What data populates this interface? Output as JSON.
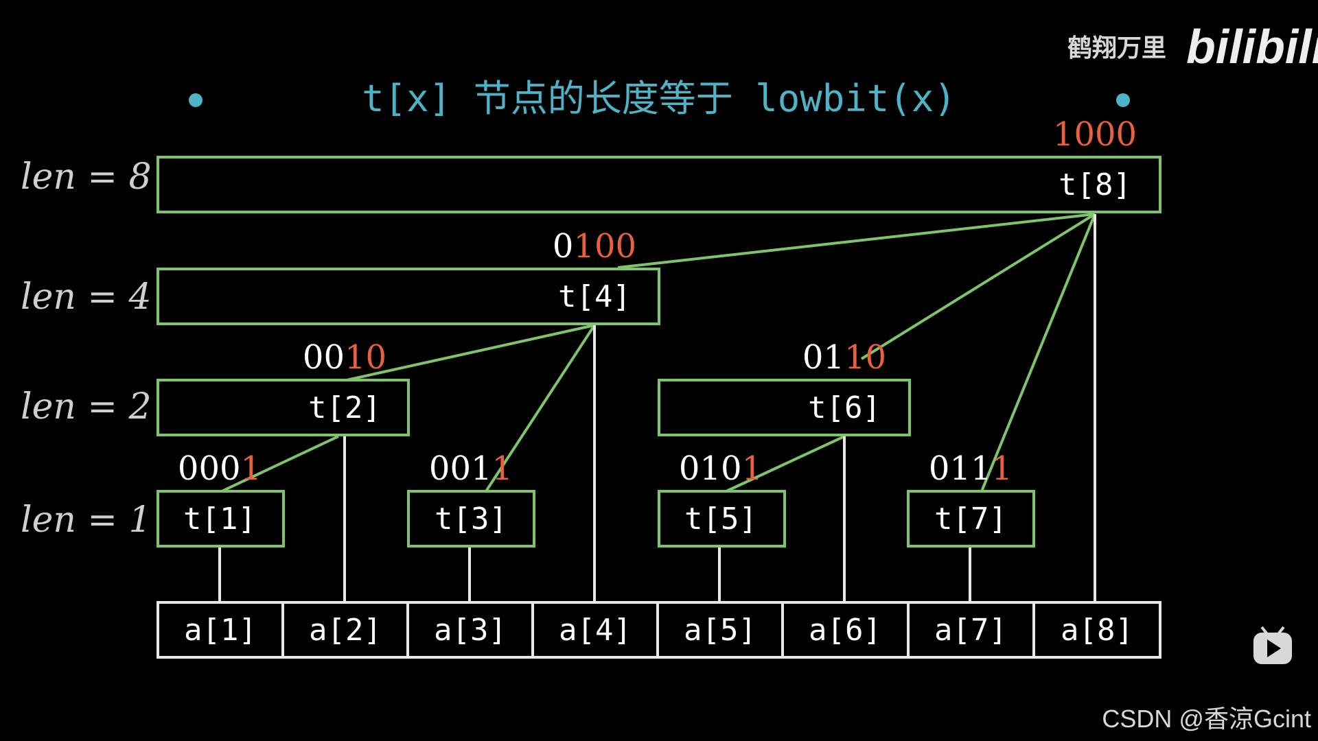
{
  "title": "t[x] 节点的长度等于 lowbit(x)",
  "len_labels": [
    "len = 8",
    "len = 4",
    "len = 2",
    "len = 1"
  ],
  "t_nodes": [
    {
      "label": "t[1]",
      "bin_prefix": "000",
      "bin_suffix": "1"
    },
    {
      "label": "t[2]",
      "bin_prefix": "00",
      "bin_suffix": "10"
    },
    {
      "label": "t[3]",
      "bin_prefix": "001",
      "bin_suffix": "1"
    },
    {
      "label": "t[4]",
      "bin_prefix": "0",
      "bin_suffix": "100"
    },
    {
      "label": "t[5]",
      "bin_prefix": "010",
      "bin_suffix": "1"
    },
    {
      "label": "t[6]",
      "bin_prefix": "01",
      "bin_suffix": "10"
    },
    {
      "label": "t[7]",
      "bin_prefix": "011",
      "bin_suffix": "1"
    },
    {
      "label": "t[8]",
      "bin_prefix": "",
      "bin_suffix": "1000"
    }
  ],
  "a_cells": [
    "a[1]",
    "a[2]",
    "a[3]",
    "a[4]",
    "a[5]",
    "a[6]",
    "a[7]",
    "a[8]"
  ],
  "watermark_top": "鹤翔万里",
  "watermark_logo": "bilibili",
  "watermark_bottom": "CSDN @香涼Gcint",
  "colors": {
    "box": "#7ec46a",
    "title": "#4fb3c8",
    "highlight": "#e8603c",
    "text": "#ffffff",
    "background": "#000000"
  }
}
